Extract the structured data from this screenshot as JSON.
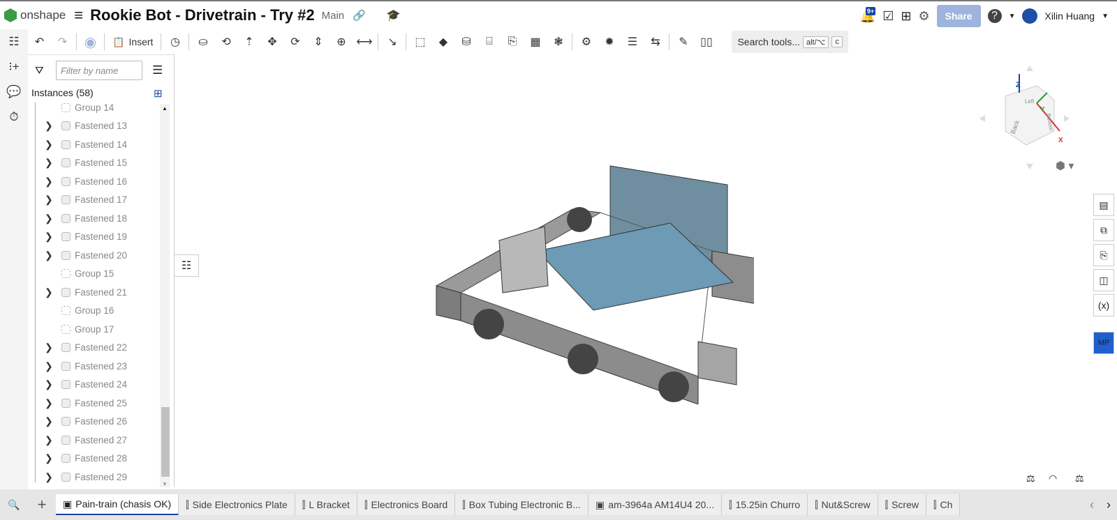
{
  "app": {
    "logo_text": "onshape",
    "title": "Rookie Bot - Drivetrain - Try #2",
    "branch": "Main"
  },
  "header": {
    "notifications_badge": "9+",
    "share_label": "Share",
    "user_name": "Xilin Huang"
  },
  "toolbar": {
    "insert_label": "Insert",
    "search_label": "Search tools...",
    "search_kbd1": "alt/⌥",
    "search_kbd2": "c",
    "icons": [
      "mate-connector-icon",
      "fastened-mate-icon",
      "revolute-mate-icon",
      "slider-mate-icon",
      "planar-mate-icon",
      "cylindrical-mate-icon",
      "pin-slot-mate-icon",
      "ball-mate-icon",
      "parallel-mate-icon",
      "tangent-mate-icon",
      "group-icon",
      "replicate-icon",
      "pattern-icon",
      "relation-icon",
      "gear-relation-icon",
      "rack-pinion-icon",
      "screw-relation-icon",
      "linear-relation-icon",
      "mate-feature-icon",
      "gears-icon",
      "gear-icon",
      "frame-icon",
      "rename-icon",
      "bom-icon",
      "explode-icon"
    ]
  },
  "panel": {
    "filter_placeholder": "Filter by name",
    "instances_label": "Instances (58)",
    "items": [
      {
        "label": "Group 14",
        "type": "group",
        "expand": false
      },
      {
        "label": "Fastened 13",
        "type": "fastened",
        "expand": true
      },
      {
        "label": "Fastened 14",
        "type": "fastened",
        "expand": true
      },
      {
        "label": "Fastened 15",
        "type": "fastened",
        "expand": true
      },
      {
        "label": "Fastened 16",
        "type": "fastened",
        "expand": true
      },
      {
        "label": "Fastened 17",
        "type": "fastened",
        "expand": true
      },
      {
        "label": "Fastened 18",
        "type": "fastened",
        "expand": true
      },
      {
        "label": "Fastened 19",
        "type": "fastened",
        "expand": true
      },
      {
        "label": "Fastened 20",
        "type": "fastened",
        "expand": true
      },
      {
        "label": "Group 15",
        "type": "group",
        "expand": false
      },
      {
        "label": "Fastened 21",
        "type": "fastened",
        "expand": true
      },
      {
        "label": "Group 16",
        "type": "group",
        "expand": false
      },
      {
        "label": "Group 17",
        "type": "group",
        "expand": false
      },
      {
        "label": "Fastened 22",
        "type": "fastened",
        "expand": true
      },
      {
        "label": "Fastened 23",
        "type": "fastened",
        "expand": true
      },
      {
        "label": "Fastened 24",
        "type": "fastened",
        "expand": true
      },
      {
        "label": "Fastened 25",
        "type": "fastened",
        "expand": true
      },
      {
        "label": "Fastened 26",
        "type": "fastened",
        "expand": true
      },
      {
        "label": "Fastened 27",
        "type": "fastened",
        "expand": true
      },
      {
        "label": "Fastened 28",
        "type": "fastened",
        "expand": true
      },
      {
        "label": "Fastened 29",
        "type": "fastened",
        "expand": true
      }
    ]
  },
  "viewcube": {
    "z": "Z",
    "y": "Y",
    "x": "X",
    "faces": [
      "Left",
      "Back",
      "Bottom"
    ]
  },
  "right_panel": {
    "mp_label": "MP"
  },
  "tabs": [
    {
      "label": "Pain-train (chasis OK)",
      "active": true,
      "type": "assembly"
    },
    {
      "label": "Side Electronics Plate",
      "type": "part-studio"
    },
    {
      "label": "L Bracket",
      "type": "part-studio"
    },
    {
      "label": "Electronics Board",
      "type": "part-studio"
    },
    {
      "label": "Box Tubing Electronic B...",
      "type": "part-studio"
    },
    {
      "label": "am-3964a AM14U4 20...",
      "type": "assembly"
    },
    {
      "label": "15.25in Churro",
      "type": "part-studio"
    },
    {
      "label": "Nut&Screw",
      "type": "part-studio"
    },
    {
      "label": "Screw",
      "type": "part-studio"
    },
    {
      "label": "Ch",
      "type": "part-studio"
    }
  ],
  "colors": {
    "accent": "#1646a0",
    "share": "#9db4dc",
    "brand": "#3a9c46"
  }
}
